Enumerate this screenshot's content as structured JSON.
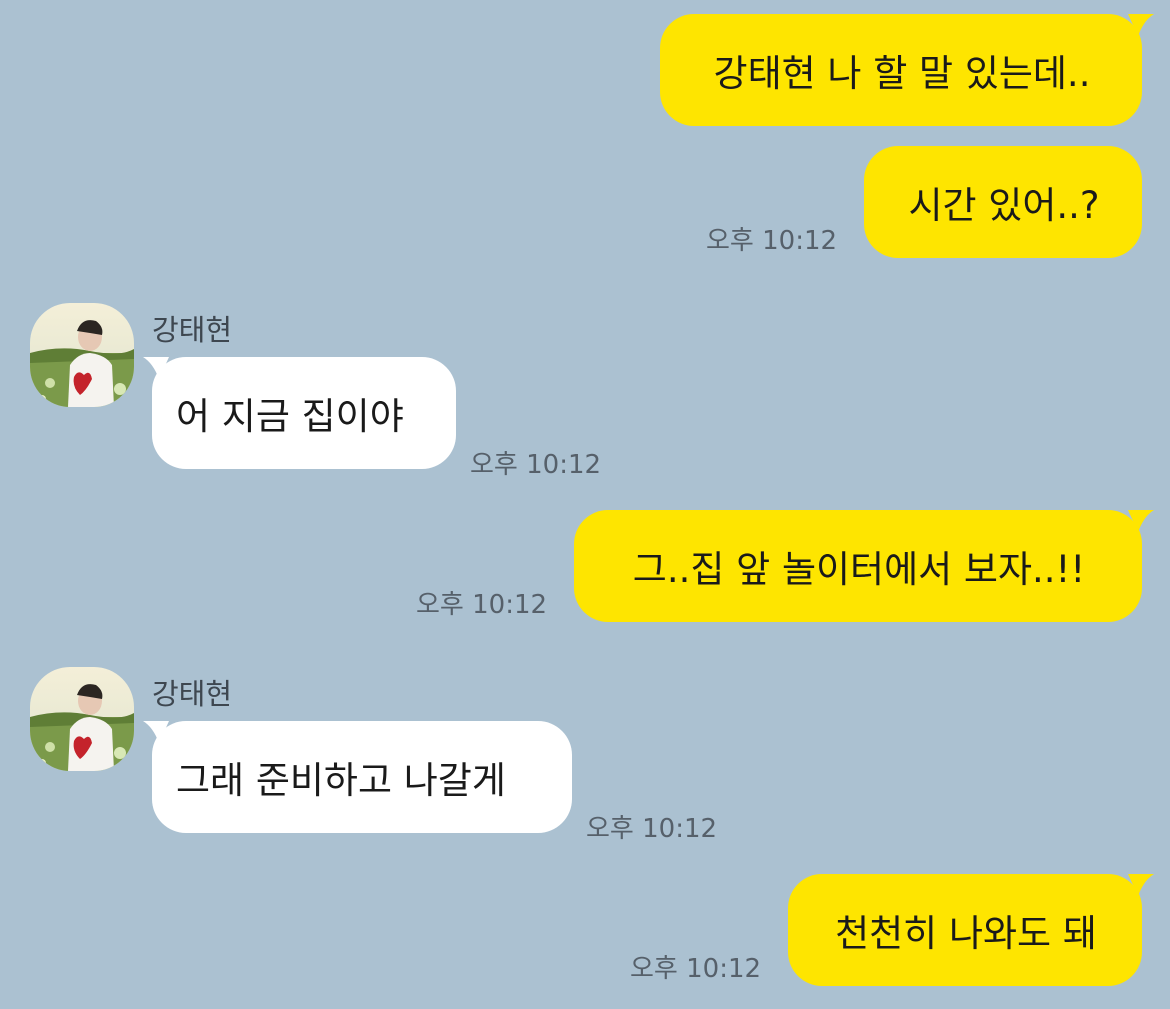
{
  "colors": {
    "background": "#abc1d1",
    "my_bubble": "#fee500",
    "their_bubble": "#ffffff",
    "timestamp": "#56606a"
  },
  "contact": {
    "name": "강태현",
    "avatar_icon": "profile-photo-icon"
  },
  "messages": [
    {
      "sender": "me",
      "text": "강태현 나 할 말 있는데..",
      "time": ""
    },
    {
      "sender": "me",
      "text": "시간 있어..?",
      "time": "오후 10:12"
    },
    {
      "sender": "them",
      "name": "강태현",
      "text": "어 지금 집이야",
      "time": "오후 10:12"
    },
    {
      "sender": "me",
      "text": "그..집 앞 놀이터에서 보자..!!",
      "time": "오후 10:12"
    },
    {
      "sender": "them",
      "name": "강태현",
      "text": "그래 준비하고 나갈게",
      "time": "오후 10:12"
    },
    {
      "sender": "me",
      "text": "천천히 나와도 돼",
      "time": "오후 10:12"
    }
  ]
}
